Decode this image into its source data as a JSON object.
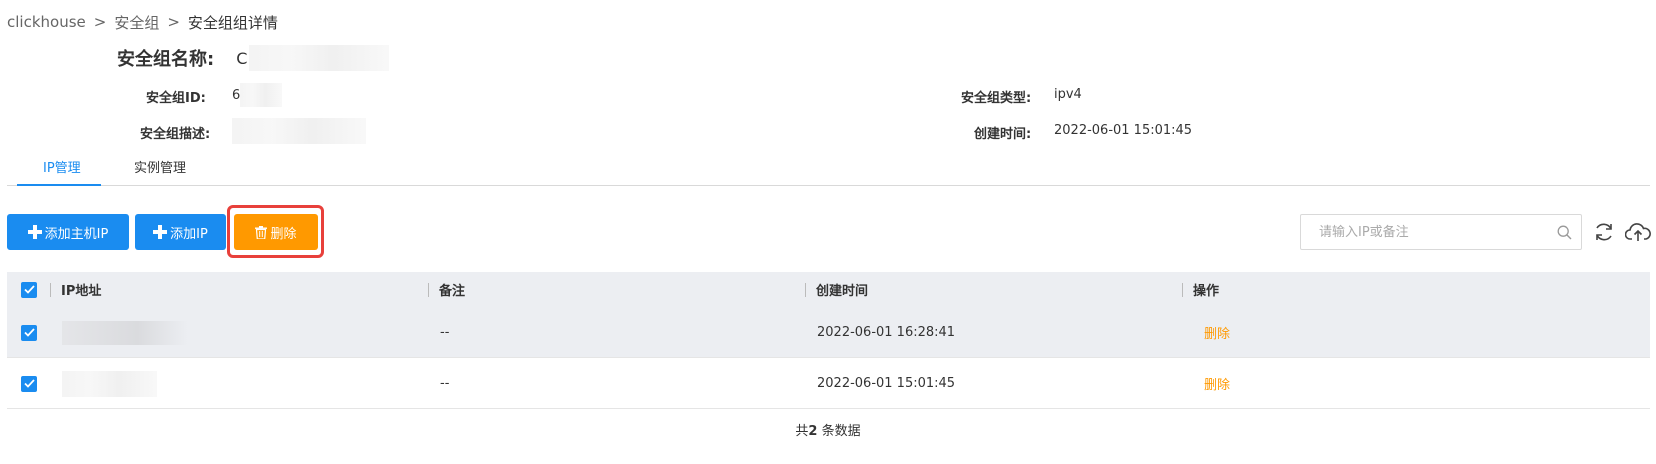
{
  "breadcrumb": {
    "items": [
      "clickhouse",
      "安全组"
    ],
    "separator": ">",
    "current": "安全组组详情"
  },
  "detail": {
    "name_label": "安全组名称:",
    "name_value": "C",
    "id_label": "安全组ID:",
    "id_value": "6",
    "desc_label": "安全组描述:",
    "type_label": "安全组类型:",
    "type_value": "ipv4",
    "created_label": "创建时间:",
    "created_value": "2022-06-01 15:01:45"
  },
  "tabs": [
    {
      "label": "IP管理",
      "active": true
    },
    {
      "label": "实例管理",
      "active": false
    }
  ],
  "toolbar": {
    "add_host_ip_label": "添加主机IP",
    "add_ip_label": "添加IP",
    "delete_label": "删除",
    "search_placeholder": "请输入IP或备注",
    "refresh_icon": "refresh-icon",
    "upload_icon": "cloud-upload-icon"
  },
  "table": {
    "columns": [
      "IP地址",
      "备注",
      "创建时间",
      "操作"
    ],
    "rows": [
      {
        "checked": true,
        "ip": "",
        "note": "--",
        "created": "2022-06-01 16:28:41",
        "action": "删除"
      },
      {
        "checked": true,
        "ip": "",
        "note": "--",
        "created": "2022-06-01 15:01:45",
        "action": "删除"
      }
    ]
  },
  "footer": {
    "prefix": "共",
    "count": "2",
    "suffix": " 条数据"
  },
  "colors": {
    "primary": "#1a8cf0",
    "warning": "#ff9900",
    "highlight": "#e8403b"
  }
}
